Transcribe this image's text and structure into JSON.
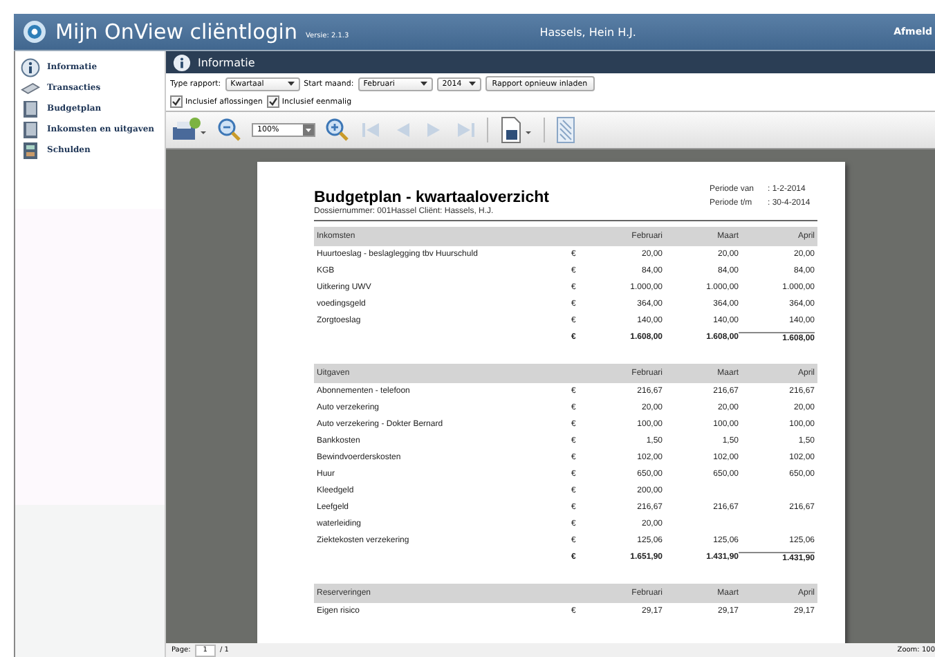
{
  "header": {
    "app_title": "Mijn OnView cliëntlogin",
    "version": "Versie: 2.1.3",
    "user": "Hassels, Hein H.J.",
    "logout": "Afmeld"
  },
  "sidebar": {
    "items": [
      {
        "label": "Informatie",
        "kind": "info"
      },
      {
        "label": "Transacties",
        "kind": "card"
      },
      {
        "label": "Budgetplan",
        "kind": "book"
      },
      {
        "label": "Inkomsten en uitgaven",
        "kind": "book"
      },
      {
        "label": "Schulden",
        "kind": "calc"
      }
    ]
  },
  "panel": {
    "title": "Informatie"
  },
  "filters": {
    "type_label": "Type rapport:",
    "type_value": "Kwartaal",
    "month_label": "Start maand:",
    "month_value": "Februari",
    "year_value": "2014",
    "reload_button": "Rapport opnieuw inladen",
    "checkboxes": [
      {
        "label": "Inclusief aflossingen",
        "checked": true
      },
      {
        "label": "Inclusief eenmalig",
        "checked": true
      }
    ]
  },
  "toolbar": {
    "zoom_value": "100%"
  },
  "report": {
    "title": "Budgetplan - kwartaaloverzicht",
    "dossier": "Dossiernummer: 001Hassel   Cliënt: Hassels, H.J.",
    "periods": [
      {
        "label": "Periode van",
        "value": ": 1-2-2014"
      },
      {
        "label": "Periode t/m",
        "value": ": 30-4-2014"
      }
    ],
    "sections": [
      {
        "title": "Inkomsten",
        "columns": [
          "Februari",
          "Maart",
          "April"
        ],
        "rows": [
          {
            "name": "Huurtoeslag - beslaglegging tbv Huurschuld",
            "currency": "€",
            "values": [
              "20,00",
              "20,00",
              "20,00"
            ]
          },
          {
            "name": "KGB",
            "currency": "€",
            "values": [
              "84,00",
              "84,00",
              "84,00"
            ]
          },
          {
            "name": "Uitkering UWV",
            "currency": "€",
            "values": [
              "1.000,00",
              "1.000,00",
              "1.000,00"
            ]
          },
          {
            "name": "voedingsgeld",
            "currency": "€",
            "values": [
              "364,00",
              "364,00",
              "364,00"
            ]
          },
          {
            "name": "Zorgtoeslag",
            "currency": "€",
            "values": [
              "140,00",
              "140,00",
              "140,00"
            ]
          }
        ],
        "total": {
          "currency": "€",
          "values": [
            "1.608,00",
            "1.608,00",
            "1.608,00"
          ]
        }
      },
      {
        "title": "Uitgaven",
        "columns": [
          "Februari",
          "Maart",
          "April"
        ],
        "rows": [
          {
            "name": "Abonnementen - telefoon",
            "currency": "€",
            "values": [
              "216,67",
              "216,67",
              "216,67"
            ]
          },
          {
            "name": "Auto verzekering",
            "currency": "€",
            "values": [
              "20,00",
              "20,00",
              "20,00"
            ]
          },
          {
            "name": "Auto verzekering - Dokter Bernard",
            "currency": "€",
            "values": [
              "100,00",
              "100,00",
              "100,00"
            ]
          },
          {
            "name": "Bankkosten",
            "currency": "€",
            "values": [
              "1,50",
              "1,50",
              "1,50"
            ]
          },
          {
            "name": "Bewindvoerderskosten",
            "currency": "€",
            "values": [
              "102,00",
              "102,00",
              "102,00"
            ]
          },
          {
            "name": "Huur",
            "currency": "€",
            "values": [
              "650,00",
              "650,00",
              "650,00"
            ]
          },
          {
            "name": "Kleedgeld",
            "currency": "€",
            "values": [
              "200,00"
            ]
          },
          {
            "name": "Leefgeld",
            "currency": "€",
            "values": [
              "216,67",
              "216,67",
              "216,67"
            ]
          },
          {
            "name": "waterleiding",
            "currency": "€",
            "values": [
              "20,00"
            ]
          },
          {
            "name": "Ziektekosten verzekering",
            "currency": "€",
            "values": [
              "125,06",
              "125,06",
              "125,06"
            ]
          }
        ],
        "total": {
          "currency": "€",
          "values": [
            "1.651,90",
            "1.431,90",
            "1.431,90"
          ]
        }
      },
      {
        "title": "Reserveringen",
        "columns": [
          "Februari",
          "Maart",
          "April"
        ],
        "rows": [
          {
            "name": "Eigen risico",
            "currency": "€",
            "values": [
              "29,17",
              "29,17",
              "29,17"
            ]
          }
        ]
      }
    ]
  },
  "status": {
    "page_label": "Page:",
    "page_value": "1",
    "page_total": "/ 1",
    "zoom": "Zoom: 100"
  }
}
